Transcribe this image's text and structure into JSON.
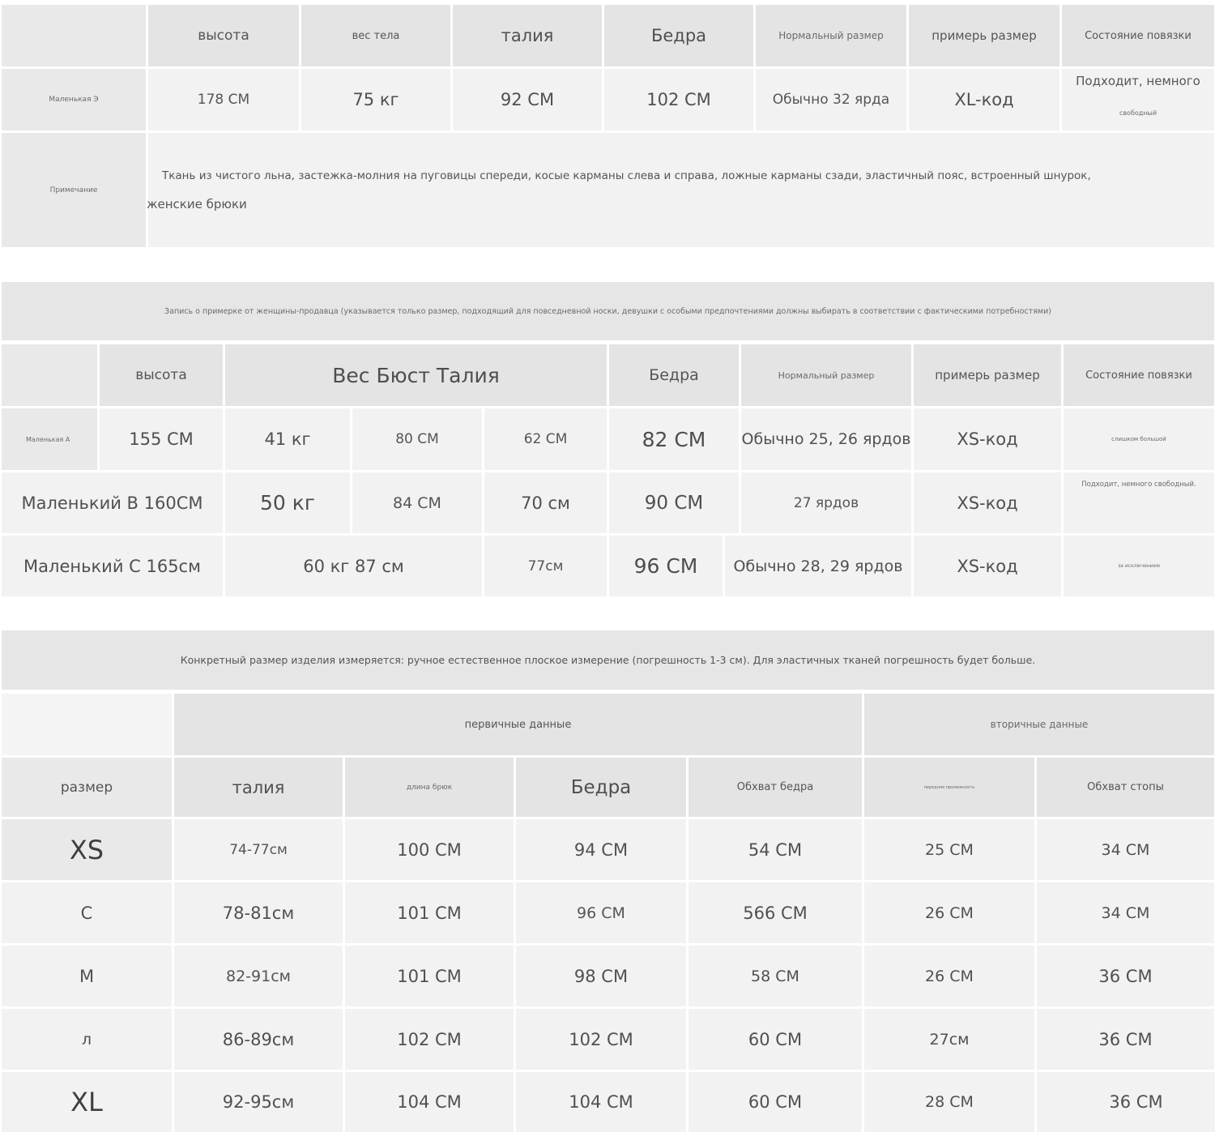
{
  "table1": {
    "headers": [
      "высота",
      "вес тела",
      "талия",
      "Бедра",
      "Нормальный размер",
      "примерь размер",
      "Состояние повязки"
    ],
    "row": {
      "label": "Маленькая Э",
      "values": [
        "178 СМ",
        "75 кг",
        "92 СМ",
        "102 СМ",
        "Обычно 32 ярда",
        "XL-код"
      ],
      "status_line1": "Подходит, немного",
      "status_line2": "свободный"
    },
    "note_label": "Примечание",
    "note_line1": "Ткань из чистого льна, застежка-молния на пуговицы спереди, косые карманы слева и справа, ложные карманы сзади, эластичный пояс, встроенный шнурок,",
    "note_line2": "женские брюки"
  },
  "table2": {
    "banner": "Запись о примерке от женщины-продавца (указывается только размер, подходящий для повседневной носки, девушки с особыми предпочтениями должны выбирать в соответствии с фактическими потребностями)",
    "headers": {
      "height": "высота",
      "merged": "Вес Бюст Талия",
      "hips": "Бедра",
      "normal": "Нормальный размер",
      "try": "примерь размер",
      "status": "Состояние повязки"
    },
    "row_a": {
      "label": "Маленькая А",
      "height": "155 СМ",
      "weight": "41 кг",
      "bust": "80 СМ",
      "waist": "62 СМ",
      "hips": "82 СМ",
      "normal": "Обычно 25, 26 ярдов",
      "try": "XS-код",
      "status": "слишком большой"
    },
    "row_b": {
      "label": "Маленький В 160СМ",
      "weight": "50 кг",
      "bust": "84 СМ",
      "waist": "70 см",
      "hips": "90 СМ",
      "normal": "27 ярдов",
      "try": "XS-код",
      "status": "Подходит, немного свободный."
    },
    "row_c": {
      "label": "Маленький С 165см",
      "weight_bust": "60 кг 87 см",
      "waist": "77см",
      "hips": "96 СМ",
      "normal": "Обычно 28, 29 ярдов",
      "try": "XS-код",
      "status": "за исключением"
    }
  },
  "table3": {
    "banner": "Конкретный размер изделия измеряется: ручное естественное плоское измерение (погрешность 1-3 см). Для эластичных тканей погрешность будет больше.",
    "group_primary": "первичные данные",
    "group_secondary": "вторичные данные",
    "headers": [
      "размер",
      "талия",
      "длина брюк",
      "Бедра",
      "Обхват бедра",
      "передняя промежность",
      "Обхват стопы"
    ],
    "rows": [
      {
        "size": "XS",
        "values": [
          "74-77см",
          "100 СМ",
          "94 СМ",
          "54 СМ",
          "25 СМ",
          "34 СМ"
        ]
      },
      {
        "size": "С",
        "values": [
          "78-81см",
          "101 СМ",
          "96 СМ",
          "566 СМ",
          "26 СМ",
          "34 СМ"
        ]
      },
      {
        "size": "М",
        "values": [
          "82-91см",
          "101 СМ",
          "98 СМ",
          "58 СМ",
          "26 СМ",
          "36 СМ"
        ]
      },
      {
        "size": "л",
        "values": [
          "86-89см",
          "102 СМ",
          "102 СМ",
          "60 СМ",
          "27см",
          "36 СМ"
        ]
      },
      {
        "size": "XL",
        "values": [
          "92-95см",
          "104 СМ",
          "104 СМ",
          "60 СМ",
          "28 СМ",
          "36 СМ"
        ]
      }
    ]
  }
}
